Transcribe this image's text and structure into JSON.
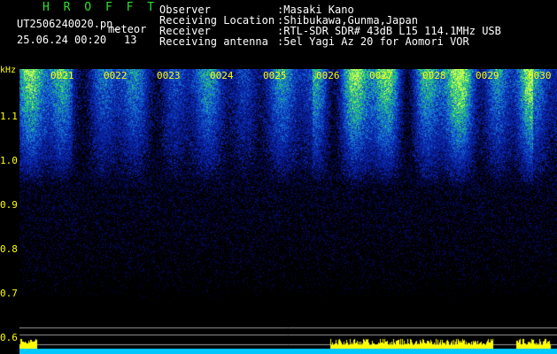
{
  "header": {
    "app_title": "H R O F F T",
    "file_name": "UT2506240020.pn_",
    "mode": "meteor",
    "date_time": "25.06.24 00:20",
    "count": "13"
  },
  "info": [
    {
      "label": "Observer",
      "value": ":Masaki Kano"
    },
    {
      "label": "Receiving Location",
      "value": ":Shibukawa,Gunma,Japan"
    },
    {
      "label": "Receiver",
      "value": ":RTL-SDR SDR# 43dB L15 114.1MHz USB"
    },
    {
      "label": "Receiving antenna",
      "value": ":5el Yagi Az 20 for Aomori VOR"
    }
  ],
  "axis": {
    "unit": "kHz",
    "y_ticks": [
      "1.1",
      "1.0",
      "0.9",
      "0.8",
      "0.7",
      "0.6"
    ],
    "time_ticks": [
      "0021",
      "0022",
      "0023",
      "0024",
      "0025",
      "0026",
      "0027",
      "0028",
      "0029",
      "0030"
    ]
  },
  "colors": {
    "title": "#2fe02f",
    "axis_text": "#ffff00",
    "background": "#000000",
    "level_bar": "#ffff00",
    "noise_floor": "#00c8ff"
  }
}
